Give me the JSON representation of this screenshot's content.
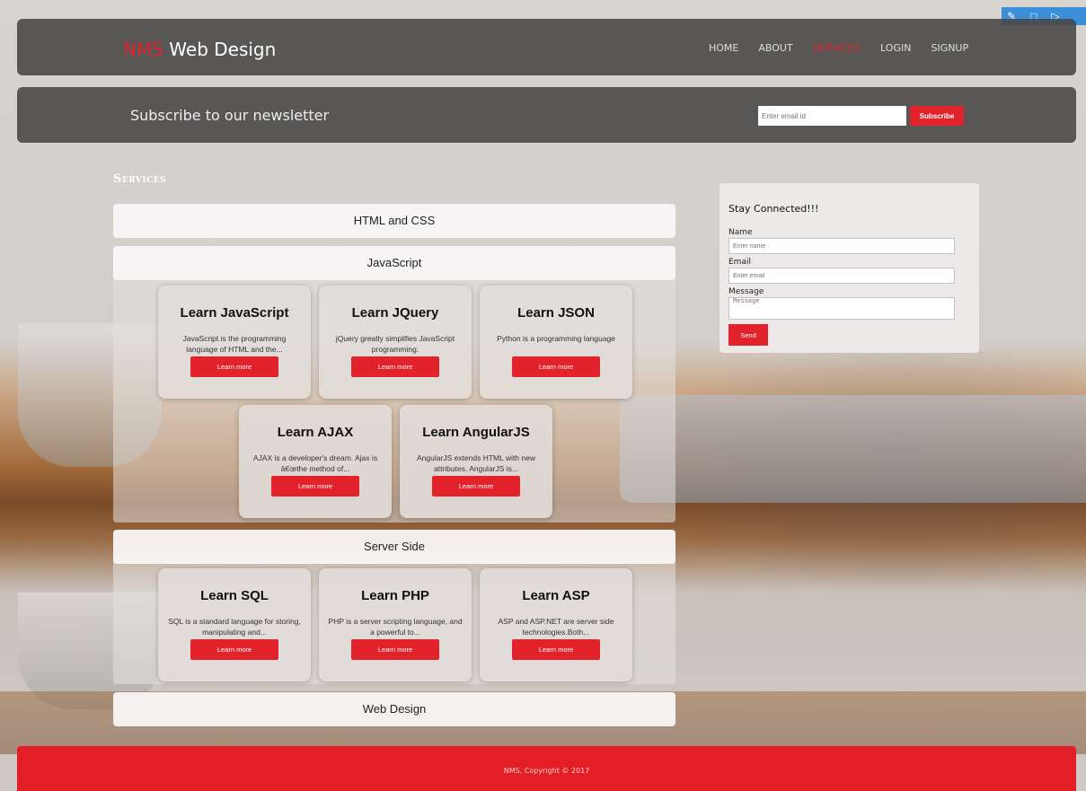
{
  "header": {
    "brand_accent": "NMS",
    "brand_rest": " Web Design",
    "nav": [
      "HOME",
      "ABOUT",
      "SERVICES",
      "LOGIN",
      "SIGNUP"
    ],
    "active_nav": "SERVICES"
  },
  "newsletter": {
    "title": "Subscribe to our newsletter",
    "email_placeholder": "Enter email id",
    "button": "Subscribe"
  },
  "services": {
    "heading": "Services",
    "sections": [
      {
        "title": "HTML and CSS"
      },
      {
        "title": "JavaScript"
      },
      {
        "title": "Server Side"
      },
      {
        "title": "Web Design"
      }
    ],
    "javascript_cards": [
      {
        "title": "Learn JavaScript",
        "desc": "JavaScript is the programming language of HTML and the...",
        "button": "Learn more"
      },
      {
        "title": "Learn JQuery",
        "desc": "jQuery greatly simplifies JavaScript programming.",
        "button": "Learn more"
      },
      {
        "title": "Learn JSON",
        "desc": "Python is a programming language",
        "button": "Learn more"
      },
      {
        "title": "Learn AJAX",
        "desc": "AJAX is a developer's dream. Ajax is â€œthe method of...",
        "button": "Learn more"
      },
      {
        "title": "Learn AngularJS",
        "desc": "AngularJS extends HTML with new attributes. AngularJS is...",
        "button": "Learn more"
      }
    ],
    "server_cards": [
      {
        "title": "Learn SQL",
        "desc": "SQL is a standard language for storing, manipulating and...",
        "button": "Learn more"
      },
      {
        "title": "Learn PHP",
        "desc": "PHP is a server scripting language, and a powerful to...",
        "button": "Learn more"
      },
      {
        "title": "Learn ASP",
        "desc": "ASP and ASP.NET are server side technologies.Both...",
        "button": "Learn more"
      }
    ]
  },
  "connect": {
    "title": "Stay Connected!!!",
    "name_label": "Name",
    "name_placeholder": "Enter name",
    "email_label": "Email",
    "email_placeholder": "Enter email",
    "message_label": "Message",
    "message_placeholder": "Message",
    "send": "Send"
  },
  "footer": {
    "text": "NMS, Copyright © 2017"
  },
  "colors": {
    "accent": "#e3232b",
    "bar": "#484644",
    "footer": "#e31e26"
  }
}
